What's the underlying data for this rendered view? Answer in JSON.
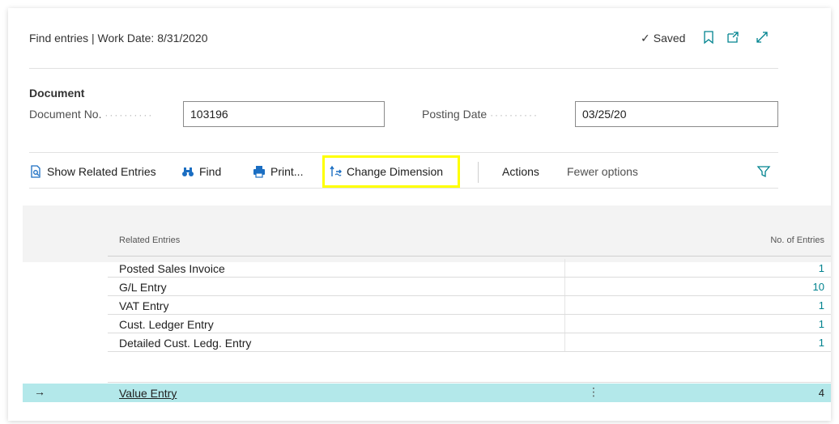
{
  "header": {
    "title": "Find entries | Work Date: 8/31/2020",
    "saved_label": "Saved",
    "icons": [
      "bookmark-icon",
      "open-new-window-icon",
      "expand-icon"
    ]
  },
  "document": {
    "section_title": "Document",
    "doc_no_label": "Document No.",
    "doc_no_value": "103196",
    "posting_date_label": "Posting Date",
    "posting_date_value": "03/25/20",
    "dots": "··········"
  },
  "toolbar": {
    "show_related": "Show Related Entries",
    "find": "Find",
    "print": "Print...",
    "change_dimension": "Change Dimension",
    "actions": "Actions",
    "fewer_options": "Fewer options"
  },
  "grid": {
    "col_related": "Related Entries",
    "col_count": "No. of Entries",
    "rows": [
      {
        "name": "Posted Sales Invoice",
        "count": "1"
      },
      {
        "name": "G/L Entry",
        "count": "10"
      },
      {
        "name": "VAT Entry",
        "count": "1"
      },
      {
        "name": "Cust. Ledger Entry",
        "count": "1"
      },
      {
        "name": "Detailed Cust. Ledg. Entry",
        "count": "1"
      },
      {
        "name": "Value Entry",
        "count": "4"
      }
    ],
    "selected_arrow": "→",
    "kebab": "⋮"
  },
  "colors": {
    "accent": "#00838f",
    "selected_row": "#b3e8ea",
    "highlight": "#ffff00"
  }
}
